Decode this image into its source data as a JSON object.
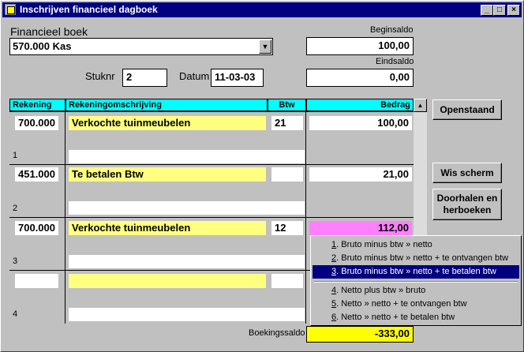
{
  "window": {
    "title": "Inschrijven financieel dagboek"
  },
  "financieel_boek": {
    "label": "Financieel boek",
    "value": "570.000  Kas"
  },
  "beginsaldo": {
    "label": "Beginsaldo",
    "value": "100,00"
  },
  "eindsaldo": {
    "label": "Eindsaldo",
    "value": "0,00"
  },
  "stuknr": {
    "label": "Stuknr",
    "value": "2"
  },
  "datum": {
    "label": "Datum",
    "value": "11-03-03"
  },
  "table": {
    "headers": {
      "rekening": "Rekening",
      "omschrijving": "Rekeningomschrijving",
      "btw": "Btw",
      "bedrag": "Bedrag"
    },
    "rows": [
      {
        "num": "1",
        "rekening": "700.000",
        "omschrijving": "Verkochte tuinmeubelen",
        "btw": "21",
        "bedrag": "100,00"
      },
      {
        "num": "2",
        "rekening": "451.000",
        "omschrijving": "Te betalen Btw",
        "btw": "",
        "bedrag": "21,00"
      },
      {
        "num": "3",
        "rekening": "700.000",
        "omschrijving": "Verkochte tuinmeubelen",
        "btw": "12",
        "bedrag": "112,00"
      },
      {
        "num": "4",
        "rekening": "",
        "omschrijving": "",
        "btw": "",
        "bedrag": ""
      }
    ]
  },
  "buttons": {
    "openstaand": "Openstaand",
    "wis_scherm": "Wis scherm",
    "doorhalen_line1": "Doorhalen en",
    "doorhalen_line2": "herboeken"
  },
  "boekingssaldo": {
    "label": "Boekingssaldo",
    "value": "-333,00"
  },
  "context_menu": {
    "items": [
      {
        "key": "1",
        "text": ". Bruto minus btw » netto"
      },
      {
        "key": "2",
        "text": ". Bruto minus btw » netto + te ontvangen btw"
      },
      {
        "key": "3",
        "text": ". Bruto minus btw » netto + te betalen btw",
        "selected": true
      },
      {
        "key": "4",
        "text": ". Netto plus btw » bruto"
      },
      {
        "key": "5",
        "text": ". Netto » netto + te ontvangen btw"
      },
      {
        "key": "6",
        "text": ". Netto » netto + te betalen btw"
      }
    ]
  },
  "colors": {
    "titlebar": "#000080",
    "header": "#00ffff",
    "description": "#ffff80",
    "highlight": "#ff80ff",
    "saldo": "#ffff00"
  }
}
